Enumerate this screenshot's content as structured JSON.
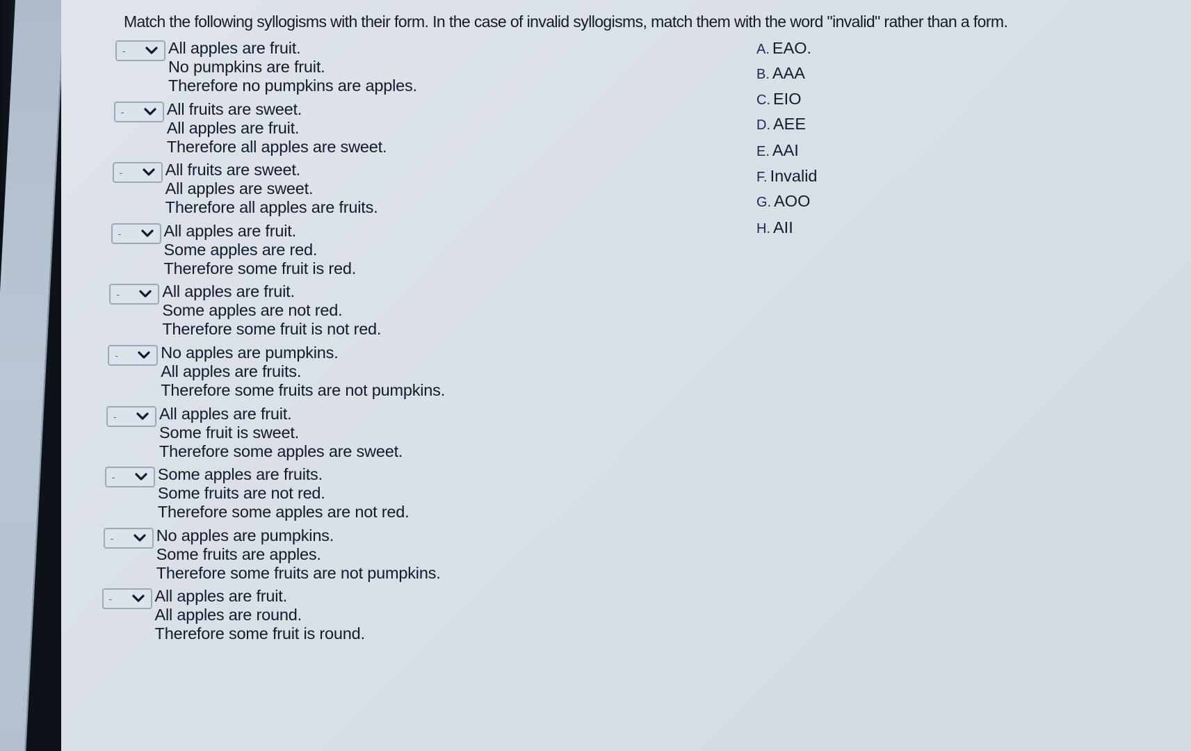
{
  "question": {
    "instructions": "Match the following syllogisms with their form.  In the case of invalid syllogisms, match them with the word \"invalid\" rather than a form."
  },
  "items": [
    {
      "selected": "-",
      "lines": [
        "All apples are fruit.",
        "No pumpkins are fruit.",
        "Therefore no pumpkins are apples."
      ]
    },
    {
      "selected": "-",
      "lines": [
        "All fruits are sweet.",
        "All apples are fruit.",
        "Therefore all apples are sweet."
      ]
    },
    {
      "selected": "-",
      "lines": [
        "All fruits are sweet.",
        "All apples are sweet.",
        "Therefore all apples are fruits."
      ]
    },
    {
      "selected": "-",
      "lines": [
        "All apples are fruit.",
        "Some apples are red.",
        "Therefore some fruit is red."
      ]
    },
    {
      "selected": "-",
      "lines": [
        "All apples are fruit.",
        "Some apples are not red.",
        "Therefore some fruit is not red."
      ]
    },
    {
      "selected": "-",
      "lines": [
        "No apples are pumpkins.",
        "All apples are fruits.",
        "Therefore some fruits are not pumpkins."
      ]
    },
    {
      "selected": "-",
      "lines": [
        "All apples are fruit.",
        "Some fruit is sweet.",
        "Therefore some apples are sweet."
      ]
    },
    {
      "selected": "-",
      "lines": [
        "Some apples are fruits.",
        "Some fruits are not red.",
        "Therefore some apples are not red."
      ]
    },
    {
      "selected": "-",
      "lines": [
        "No apples are pumpkins.",
        "Some fruits are apples.",
        "Therefore some fruits are not pumpkins."
      ]
    },
    {
      "selected": "-",
      "lines": [
        "All apples are fruit.",
        "All apples are round.",
        "Therefore some fruit is round."
      ]
    }
  ],
  "options": [
    {
      "letter": "A.",
      "form": "EAO."
    },
    {
      "letter": "B.",
      "form": "AAA"
    },
    {
      "letter": "C.",
      "form": "EIO"
    },
    {
      "letter": "D.",
      "form": "AEE"
    },
    {
      "letter": "E.",
      "form": "AAI"
    },
    {
      "letter": "F.",
      "form": "Invalid"
    },
    {
      "letter": "G.",
      "form": "AOO"
    },
    {
      "letter": "H.",
      "form": "AII"
    }
  ],
  "icons": {
    "dropdown_arrow": "chevron-down-icon"
  }
}
